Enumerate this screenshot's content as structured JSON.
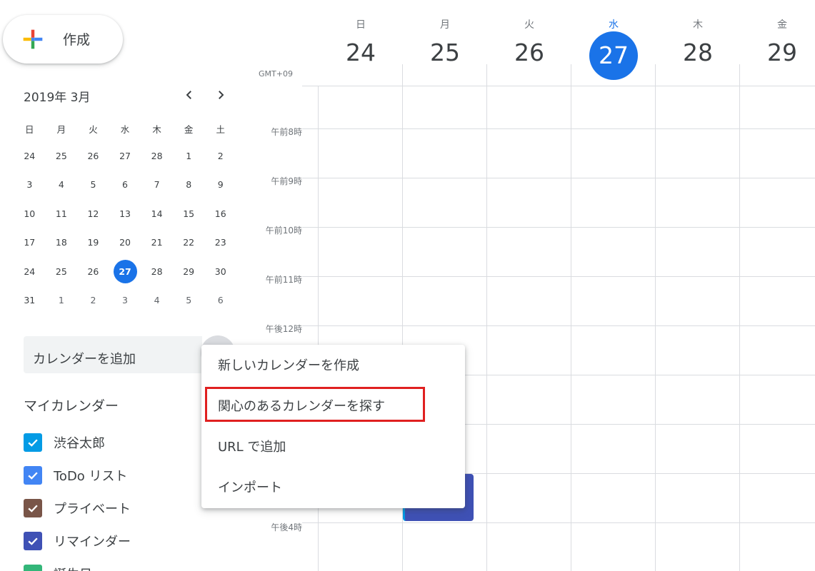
{
  "sidebar": {
    "create_label": "作成",
    "mini_calendar": {
      "title": "2019年 3月",
      "weekdays": [
        "日",
        "月",
        "火",
        "水",
        "木",
        "金",
        "土"
      ],
      "weeks": [
        [
          "24",
          "25",
          "26",
          "27",
          "28",
          "1",
          "2"
        ],
        [
          "3",
          "4",
          "5",
          "6",
          "7",
          "8",
          "9"
        ],
        [
          "10",
          "11",
          "12",
          "13",
          "14",
          "15",
          "16"
        ],
        [
          "17",
          "18",
          "19",
          "20",
          "21",
          "22",
          "23"
        ],
        [
          "24",
          "25",
          "26",
          "27",
          "28",
          "29",
          "30"
        ],
        [
          "31",
          "1",
          "2",
          "3",
          "4",
          "5",
          "6"
        ]
      ],
      "today": "27"
    },
    "add_calendar_label": "カレンダーを追加",
    "my_calendars_title": "マイカレンダー",
    "my_calendars": [
      {
        "label": "渋谷太郎",
        "color": "#039be5"
      },
      {
        "label": "ToDo リスト",
        "color": "#4285f4"
      },
      {
        "label": "プライベート",
        "color": "#795548"
      },
      {
        "label": "リマインダー",
        "color": "#3f51b5"
      },
      {
        "label": "誕生日",
        "color": "#33b679"
      }
    ]
  },
  "calendar": {
    "timezone_label": "GMT+09",
    "days": [
      {
        "name": "日",
        "num": "24"
      },
      {
        "name": "月",
        "num": "25"
      },
      {
        "name": "火",
        "num": "26"
      },
      {
        "name": "水",
        "num": "27",
        "current": true
      },
      {
        "name": "木",
        "num": "28"
      },
      {
        "name": "金",
        "num": "29"
      }
    ],
    "time_labels": [
      "午前8時",
      "午前9時",
      "午前10時",
      "午前11時",
      "午後12時",
      "午後4時"
    ],
    "accent_color": "#1a73e8"
  },
  "menu": {
    "items": [
      "新しいカレンダーを作成",
      "関心のあるカレンダーを探す",
      "URL で追加",
      "インポート"
    ],
    "highlighted_index": 1,
    "highlight_color": "#e02020"
  }
}
